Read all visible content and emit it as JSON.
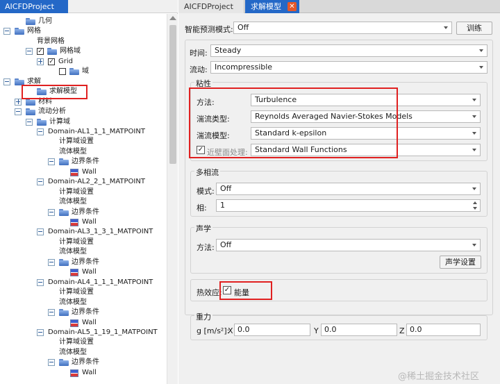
{
  "left_panel": {
    "title": "AICFDProject"
  },
  "tree": [
    {
      "label": "几何",
      "toggle": "none"
    },
    {
      "label": "网格",
      "toggle": "minus"
    },
    {
      "label": "背景网格",
      "toggle": "none"
    },
    {
      "label": "网格域",
      "toggle": "minus",
      "checked": true
    },
    {
      "label": "Grid",
      "toggle": "plus",
      "checked": true
    },
    {
      "label": "域",
      "toggle": "none",
      "checked": false
    },
    {
      "label": "求解",
      "toggle": "minus"
    },
    {
      "label": "求解模型",
      "toggle": "none"
    },
    {
      "label": "材料",
      "toggle": "plus"
    },
    {
      "label": "流动分析",
      "toggle": "minus"
    },
    {
      "label": "计算域",
      "toggle": "minus"
    },
    {
      "label": "Domain-AL1_1_1_MATPOINT",
      "toggle": "minus"
    },
    {
      "label": "计算域设置",
      "toggle": "none"
    },
    {
      "label": "流体模型",
      "toggle": "none"
    },
    {
      "label": "边界条件",
      "toggle": "minus"
    },
    {
      "label": "Wall",
      "toggle": "none"
    },
    {
      "label": "Domain-AL2_2_1_MATPOINT",
      "toggle": "minus"
    },
    {
      "label": "计算域设置",
      "toggle": "none"
    },
    {
      "label": "流体模型",
      "toggle": "none"
    },
    {
      "label": "边界条件",
      "toggle": "minus"
    },
    {
      "label": "Wall",
      "toggle": "none"
    },
    {
      "label": "Domain-AL3_1_3_1_MATPOINT",
      "toggle": "minus"
    },
    {
      "label": "计算域设置",
      "toggle": "none"
    },
    {
      "label": "流体模型",
      "toggle": "none"
    },
    {
      "label": "边界条件",
      "toggle": "minus"
    },
    {
      "label": "Wall",
      "toggle": "none"
    },
    {
      "label": "Domain-AL4_1_1_1_MATPOINT",
      "toggle": "minus"
    },
    {
      "label": "计算域设置",
      "toggle": "none"
    },
    {
      "label": "流体模型",
      "toggle": "none"
    },
    {
      "label": "边界条件",
      "toggle": "minus"
    },
    {
      "label": "Wall",
      "toggle": "none"
    },
    {
      "label": "Domain-AL5_1_19_1_MATPOINT",
      "toggle": "minus"
    },
    {
      "label": "计算域设置",
      "toggle": "none"
    },
    {
      "label": "流体模型",
      "toggle": "none"
    },
    {
      "label": "边界条件",
      "toggle": "minus"
    },
    {
      "label": "Wall",
      "toggle": "none"
    }
  ],
  "tabs": [
    {
      "label": "AICFDProject"
    },
    {
      "label": "求解模型",
      "active": true
    }
  ],
  "smart_predict": {
    "label": "智能预测模式:",
    "value": "Off",
    "train_button": "训练"
  },
  "time": {
    "label": "时间:",
    "value": "Steady"
  },
  "flow": {
    "label": "流动:",
    "value": "Incompressible"
  },
  "viscosity": {
    "title": "粘性",
    "method_label": "方法:",
    "method_value": "Turbulence",
    "turb_type_label": "湍流类型:",
    "turb_type_value": "Reynolds Averaged Navier-Stokes Models",
    "turb_model_label": "湍流模型:",
    "turb_model_value": "Standard k-epsilon",
    "near_wall_label": "近壁面处理:",
    "near_wall_checked": true,
    "near_wall_value": "Standard Wall Functions"
  },
  "multiphase": {
    "title": "多相流",
    "mode_label": "模式:",
    "mode_value": "Off",
    "phase_label": "相:",
    "phase_value": "1"
  },
  "acoustics": {
    "title": "声学",
    "method_label": "方法:",
    "method_value": "Off",
    "settings_button": "声学设置"
  },
  "thermal": {
    "label": "热效应:",
    "energy_label": "能量",
    "energy_checked": true
  },
  "gravity": {
    "title": "重力",
    "g_label": "g [m/s²]:",
    "x_label": "X",
    "x_value": "0.0",
    "y_label": "Y",
    "y_value": "0.0",
    "z_label": "Z",
    "z_value": "0.0"
  },
  "watermark": "@稀土掘金技术社区",
  "colors": {
    "accent": "#2468c7",
    "highlight": "#e02020"
  }
}
